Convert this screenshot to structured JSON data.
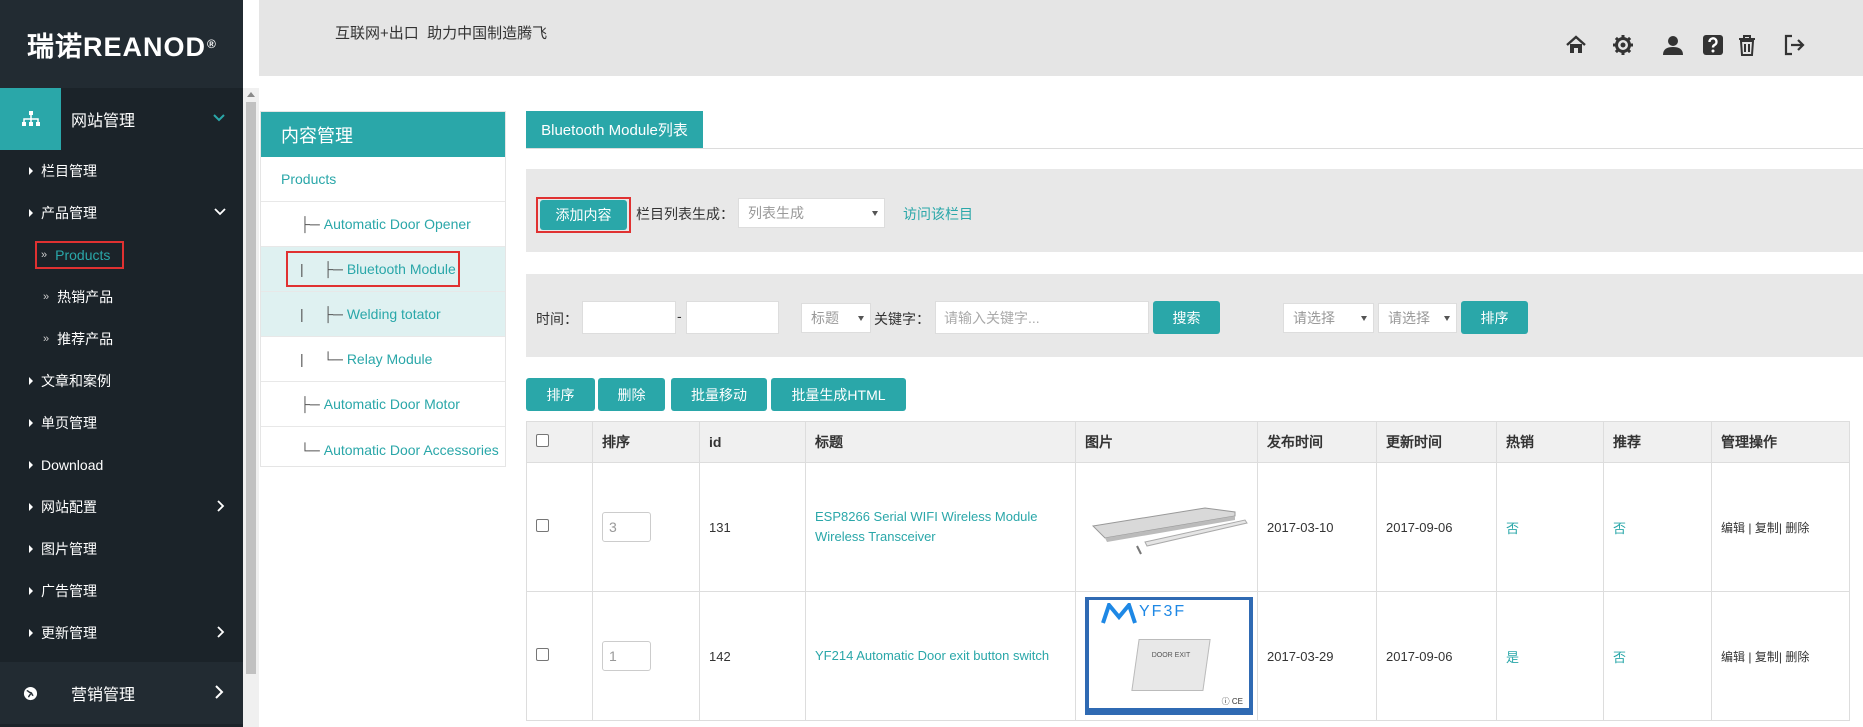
{
  "sidebar": {
    "logo": "瑞诺REANOD",
    "logo_mark": "®",
    "sections": [
      {
        "label": "网站管理",
        "icon": "sitemap-icon"
      },
      {
        "label": "营销管理",
        "icon": "globe-icon"
      }
    ],
    "items": [
      {
        "label": "栏目管理"
      },
      {
        "label": "产品管理"
      },
      {
        "label": "Products"
      },
      {
        "label": "热销产品"
      },
      {
        "label": "推荐产品"
      },
      {
        "label": "文章和案例"
      },
      {
        "label": "单页管理"
      },
      {
        "label": "Download"
      },
      {
        "label": "网站配置"
      },
      {
        "label": "图片管理"
      },
      {
        "label": "广告管理"
      },
      {
        "label": "更新管理"
      }
    ],
    "sub_marker": "»"
  },
  "header": {
    "slogan": "互联网+出口  助力中国制造腾飞",
    "icons": [
      "home-icon",
      "gear-icon",
      "user-icon",
      "help-icon",
      "trash-icon",
      "logout-icon"
    ]
  },
  "tree": {
    "title": "内容管理",
    "items": [
      {
        "label": "Products",
        "prefix": ""
      },
      {
        "label": "Automatic Door Opener",
        "prefix": "├─ "
      },
      {
        "label": "Bluetooth Module",
        "prefix": "|     ├─ "
      },
      {
        "label": "Welding totator",
        "prefix": "|     ├─ "
      },
      {
        "label": "Relay Module",
        "prefix": "|     └─ "
      },
      {
        "label": "Automatic Door Motor",
        "prefix": "├─ "
      },
      {
        "label": "Automatic Door Accessories",
        "prefix": "└─ "
      }
    ]
  },
  "main": {
    "tab": "Bluetooth Module列表",
    "toolbar": {
      "add_content": "添加内容",
      "list_gen_label": "栏目列表生成：",
      "list_gen_select": "列表生成",
      "visit_link": "访问该栏目"
    },
    "filter": {
      "time_label": "时间：",
      "dash": "-",
      "title_select": "标题",
      "keyword_label": "关键字：",
      "keyword_placeholder": "请输入关键字...",
      "search": "搜索",
      "select1": "请选择",
      "select2": "请选择",
      "sort": "排序"
    },
    "actions": [
      "排序",
      "删除",
      "批量移动",
      "批量生成HTML"
    ],
    "table": {
      "headers": [
        "排序",
        "id",
        "标题",
        "图片",
        "发布时间",
        "更新时间",
        "热销",
        "推荐",
        "管理操作"
      ],
      "rows": [
        {
          "sort": "3",
          "id": "131",
          "title": "ESP8266 Serial WIFI Wireless Module Wireless Transceiver",
          "published": "2017-03-10",
          "updated": "2017-09-06",
          "hot": "否",
          "recommend": "否",
          "op_edit": "编辑",
          "op_copy": "复制",
          "op_delete": "删除"
        },
        {
          "sort": "1",
          "id": "142",
          "title": "YF214 Automatic Door exit button switch",
          "published": "2017-03-29",
          "updated": "2017-09-06",
          "hot": "是",
          "recommend": "否",
          "op_edit": "编辑",
          "op_copy": "复制",
          "op_delete": "删除",
          "image_brand": "YF3F",
          "image_caption": "DOOR EXIT"
        }
      ]
    }
  },
  "colors": {
    "accent": "#2aa7a9",
    "sidebar": "#1b2329",
    "highlight": "#e03131"
  }
}
